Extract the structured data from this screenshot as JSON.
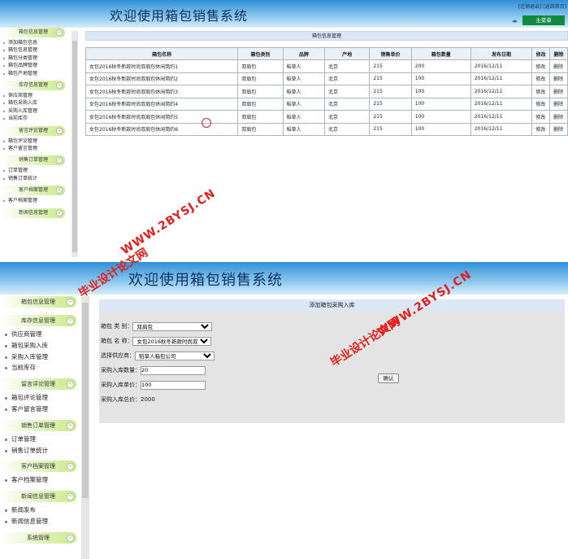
{
  "top": {
    "app_title": "欢迎使用箱包销售系统",
    "links": {
      "logout": "[注销退出]",
      "home": "[返回首页]"
    },
    "main_menu": "主菜单",
    "panel_title": "箱包信息管理",
    "columns": [
      "箱包名称",
      "箱包类别",
      "品牌",
      "产地",
      "销售单价",
      "箱包数量",
      "发布日期",
      "修改",
      "删除"
    ],
    "rows": [
      [
        "女包2016秋冬新款时尚双肩包休闲简约1",
        "双肩包",
        "稻草人",
        "北京",
        "215",
        "200",
        "2016/12/11",
        "修改",
        "删除"
      ],
      [
        "女包2016秋冬新款时尚双肩包休闲简约2",
        "双肩包",
        "稻草人",
        "北京",
        "215",
        "100",
        "2016/12/11",
        "修改",
        "删除"
      ],
      [
        "女包2016秋冬新款时尚双肩包休闲简约3",
        "双肩包",
        "稻草人",
        "北京",
        "215",
        "100",
        "2016/12/11",
        "修改",
        "删除"
      ],
      [
        "女包2016秋冬新款时尚双肩包休闲简约4",
        "双肩包",
        "稻草人",
        "北京",
        "215",
        "100",
        "2016/12/11",
        "修改",
        "删除"
      ],
      [
        "女包2016秋冬新款时尚双肩包休闲简约5",
        "双肩包",
        "稻草人",
        "北京",
        "215",
        "100",
        "2016/12/11",
        "修改",
        "删除"
      ],
      [
        "女包2016秋冬新款时尚双肩包休闲简约6",
        "双肩包",
        "稻草人",
        "北京",
        "215",
        "100",
        "2016/12/11",
        "修改",
        "删除"
      ]
    ],
    "sidebar": [
      {
        "title": "箱包信息管理",
        "items": [
          "添加箱包信息",
          "箱包信息管理",
          "箱包分类管理",
          "箱包品牌管理",
          "箱包产地管理"
        ]
      },
      {
        "title": "库存信息管理",
        "items": [
          "供应商管理",
          "箱包采购入库",
          "采购入库管理",
          "当前库存"
        ]
      },
      {
        "title": "留言评论管理",
        "items": [
          "箱包评论管理",
          "客户留言管理"
        ]
      },
      {
        "title": "销售订单管理",
        "items": [
          "订单管理",
          "销售订单统计"
        ]
      },
      {
        "title": "客户档案管理",
        "items": [
          "客户档案管理"
        ]
      },
      {
        "title": "新闻信息管理",
        "items": []
      }
    ]
  },
  "bottom": {
    "app_title": "欢迎使用箱包销售系统",
    "form_title": "添加箱包采购入库",
    "form": {
      "category_label": "箱包 类 别：",
      "category_value": "双肩包",
      "name_label": "箱包 名 称：",
      "name_value": "女包2016秋冬新款时尚双",
      "supplier_label": "选择供应商：",
      "supplier_value": "稻草人箱包公司",
      "qty_label": "采购入库数量：",
      "qty_value": "20",
      "price_label": "采购入库单价：",
      "price_value": "100",
      "total_label": "采购入库总价：",
      "total_value": "2000",
      "submit_label": "确认"
    },
    "sidebar": [
      {
        "title": "箱包信息管理",
        "items": []
      },
      {
        "title": "库存信息管理",
        "items": [
          "供应商管理",
          "箱包采购入库",
          "采购入库管理",
          "当前库存"
        ]
      },
      {
        "title": "留言评论管理",
        "items": [
          "箱包评论管理",
          "客户留言管理"
        ]
      },
      {
        "title": "销售订单管理",
        "items": [
          "订单管理",
          "销售订单统计"
        ]
      },
      {
        "title": "客户档案管理",
        "items": [
          "客户档案管理"
        ]
      },
      {
        "title": "新闻信息管理",
        "items": [
          "新闻发布",
          "新闻信息管理"
        ]
      },
      {
        "title": "系统管理",
        "items": []
      }
    ]
  },
  "watermark": {
    "url": "WWW.2BYSJ.CN",
    "text": "毕业设计论文网"
  },
  "colors": {
    "header_blue": "#2f8fd6",
    "menu_green": "#128a3e",
    "section_green": "#c8ea88",
    "watermark_red": "#e2201b"
  }
}
